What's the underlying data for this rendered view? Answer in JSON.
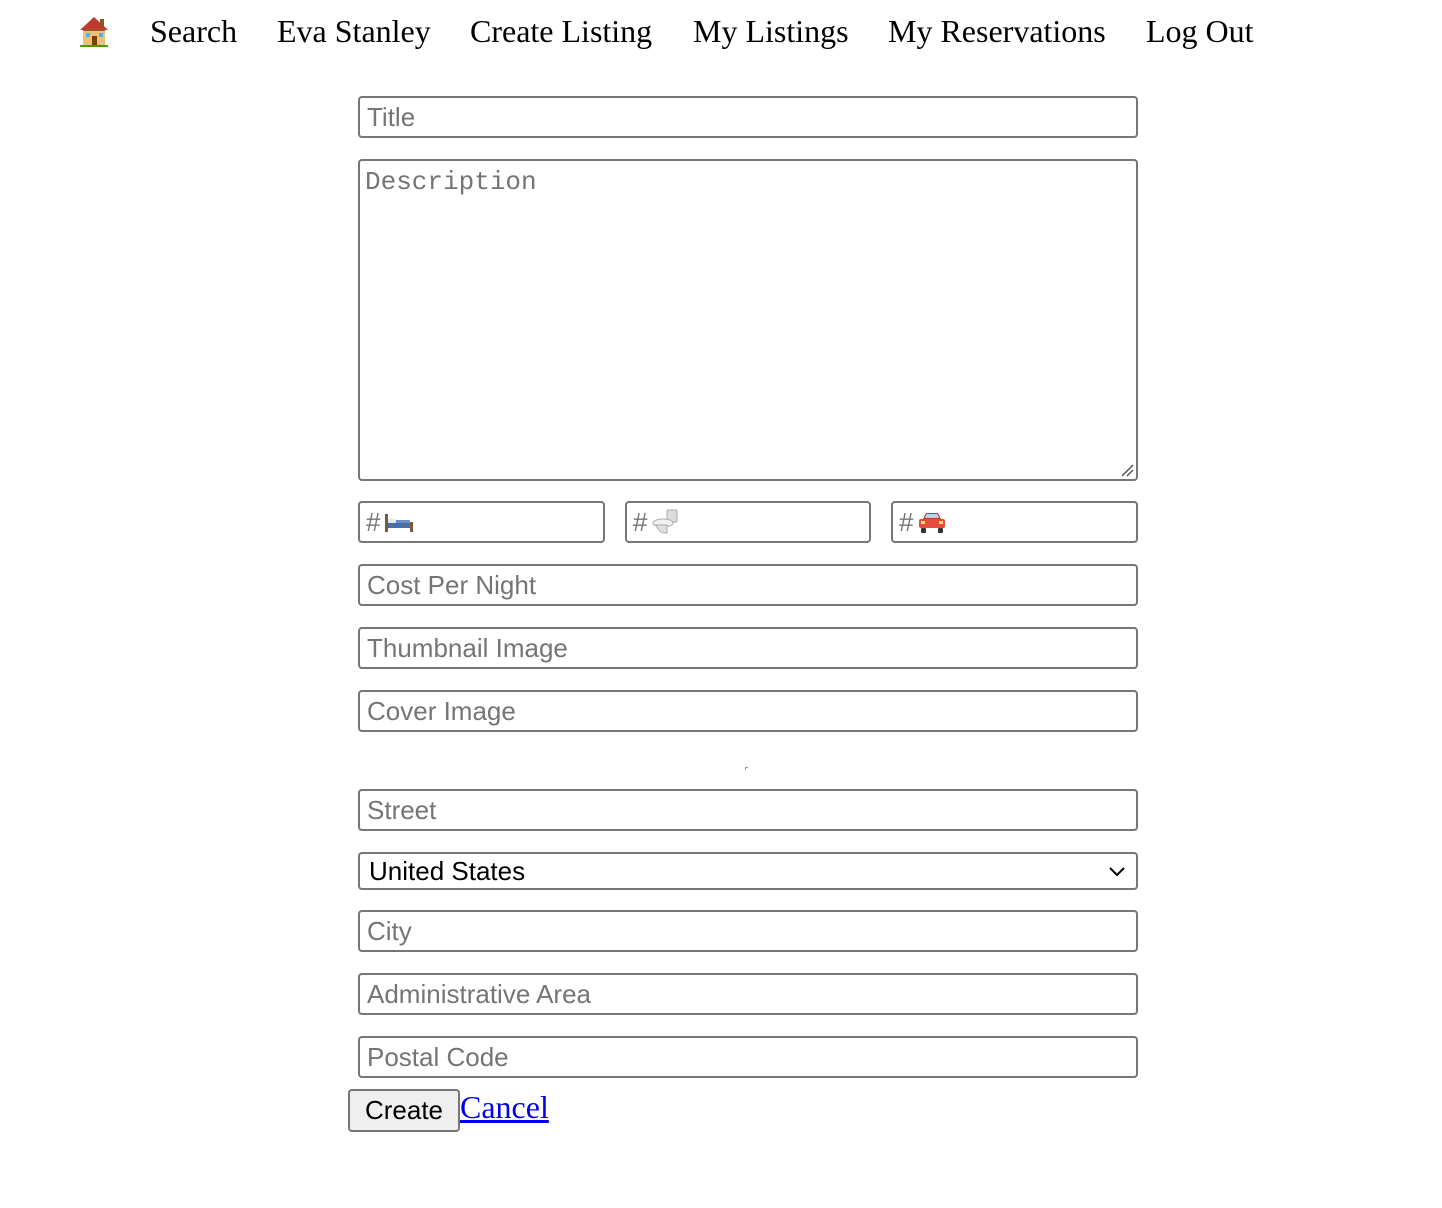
{
  "nav": {
    "home_icon": "house-icon",
    "items": [
      {
        "label": "Search"
      },
      {
        "label": "Eva Stanley"
      },
      {
        "label": "Create Listing"
      },
      {
        "label": "My Listings"
      },
      {
        "label": "My Reservations"
      },
      {
        "label": "Log Out"
      }
    ]
  },
  "form": {
    "title_placeholder": "Title",
    "description_placeholder": "Description",
    "bedrooms": {
      "prefix": "#",
      "icon": "bed-icon"
    },
    "bathrooms": {
      "prefix": "#",
      "icon": "toilet-icon"
    },
    "parking": {
      "prefix": "#",
      "icon": "car-icon"
    },
    "cost_placeholder": "Cost Per Night",
    "thumbnail_placeholder": "Thumbnail Image",
    "cover_placeholder": "Cover Image",
    "street_placeholder": "Street",
    "country_value": "United States",
    "city_placeholder": "City",
    "admin_area_placeholder": "Administrative Area",
    "postal_placeholder": "Postal Code",
    "create_label": "Create",
    "cancel_label": "Cancel"
  },
  "colors": {
    "border": "#767676",
    "placeholder": "#757575",
    "link": "#0000ee",
    "button_bg": "#efefef"
  }
}
